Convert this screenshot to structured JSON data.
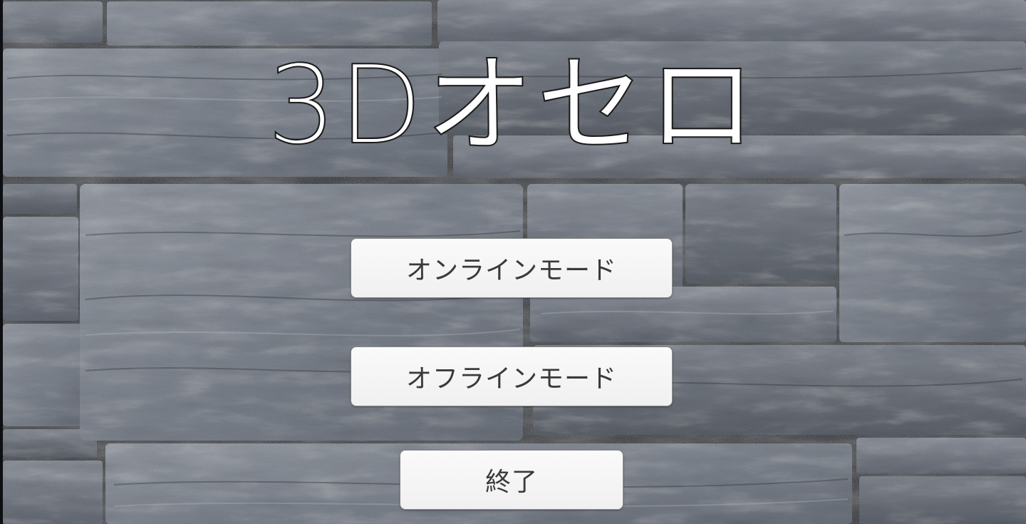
{
  "title": "3Dオセロ",
  "menu": {
    "online_label": "オンラインモード",
    "offline_label": "オフラインモード",
    "quit_label": "終了"
  },
  "colors": {
    "stone_base": "#7a808a",
    "mortar": "#1c1f24",
    "title_fill": "#ffffff",
    "title_outline": "#1a1a1a",
    "button_bg": "#f5f5f5",
    "button_text": "#3a3a3a"
  }
}
